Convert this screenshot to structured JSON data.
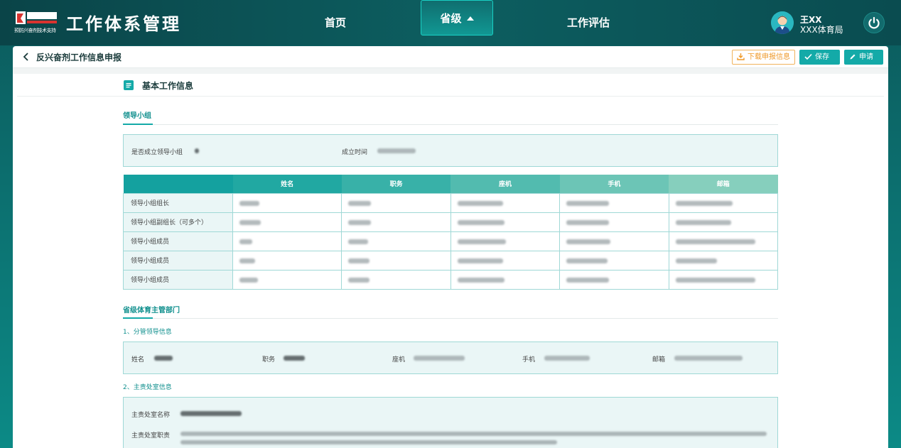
{
  "header": {
    "logo_text": "CHINADA",
    "logo_sub": "预防兴奋剂技术支持",
    "app_title": "工作体系管理",
    "nav": [
      {
        "label": "首页"
      },
      {
        "label": "省级"
      },
      {
        "label": "工作评估"
      }
    ],
    "user": {
      "name": "王XX",
      "org": "XXX体育局"
    }
  },
  "page": {
    "title": "反兴奋剂工作信息申报",
    "buttons": {
      "download": "下载申报信息",
      "save": "保存",
      "apply": "申请"
    }
  },
  "section": {
    "title": "基本工作信息",
    "leader_group": {
      "title": "领导小组",
      "established_label": "是否成立领导小组",
      "time_label": "成立时间",
      "table": {
        "headers": [
          "",
          "姓名",
          "职务",
          "座机",
          "手机",
          "邮箱"
        ],
        "rows": [
          {
            "role": "领导小组组长"
          },
          {
            "role": "领导小组副组长（可多个）"
          },
          {
            "role": "领导小组成员"
          },
          {
            "role": "领导小组成员"
          },
          {
            "role": "领导小组成员"
          }
        ]
      }
    },
    "provincial": {
      "title": "省级体育主管部门",
      "leader_info_title": "1、分管领导信息",
      "leader_fields": [
        "姓名",
        "职务",
        "座机",
        "手机",
        "邮箱"
      ],
      "office_info_title": "2、主责处室信息",
      "office_name_label": "主责处室名称",
      "office_duty_label": "主责处室职责"
    }
  },
  "colors": {
    "accent": "#14aaa8",
    "warning": "#ef9a2a",
    "header_bg": "#0c5a5c"
  }
}
